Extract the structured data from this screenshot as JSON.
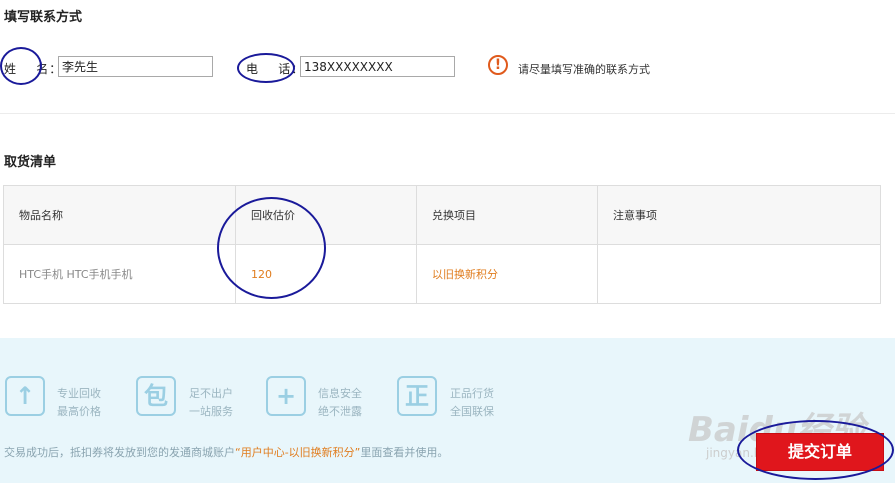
{
  "contact": {
    "title": "填写联系方式",
    "name_label": "姓    名：",
    "name_value": "李先生",
    "phone_label": "电    话：",
    "phone_value": "138XXXXXXXX",
    "hint": "请尽量填写准确的联系方式"
  },
  "pickup": {
    "title": "取货清单",
    "headers": [
      "物品名称",
      "回收估价",
      "兑换项目",
      "注意事项"
    ],
    "row": {
      "item": "HTC手机 HTC手机手机",
      "estimate": "120",
      "exchange": "以旧换新积分",
      "notes": ""
    }
  },
  "features": [
    {
      "icon": "up-arrow-icon",
      "glyph": "↑",
      "line1": "专业回收",
      "line2": "最高价格"
    },
    {
      "icon": "package-icon",
      "glyph": "包",
      "line1": "足不出户",
      "line2": "一站服务"
    },
    {
      "icon": "shield-plus-icon",
      "glyph": "+",
      "line1": "信息安全",
      "line2": "绝不泄露"
    },
    {
      "icon": "genuine-icon",
      "glyph": "正",
      "line1": "正品行货",
      "line2": "全国联保"
    }
  ],
  "notice": {
    "prefix": "交易成功后，抵扣券将发放到您的发通商城账户",
    "highlight": "“用户中心-以旧换新积分”",
    "suffix": "里面查看并使用。"
  },
  "submit_label": "提交订单",
  "watermark": {
    "logo": "Baidu经验",
    "url": "jingyan.baidu.com"
  },
  "colors": {
    "accent": "#e07d1f",
    "submit": "#e0161c",
    "annotation": "#1a1a9a",
    "panel": "#e8f6fb"
  }
}
